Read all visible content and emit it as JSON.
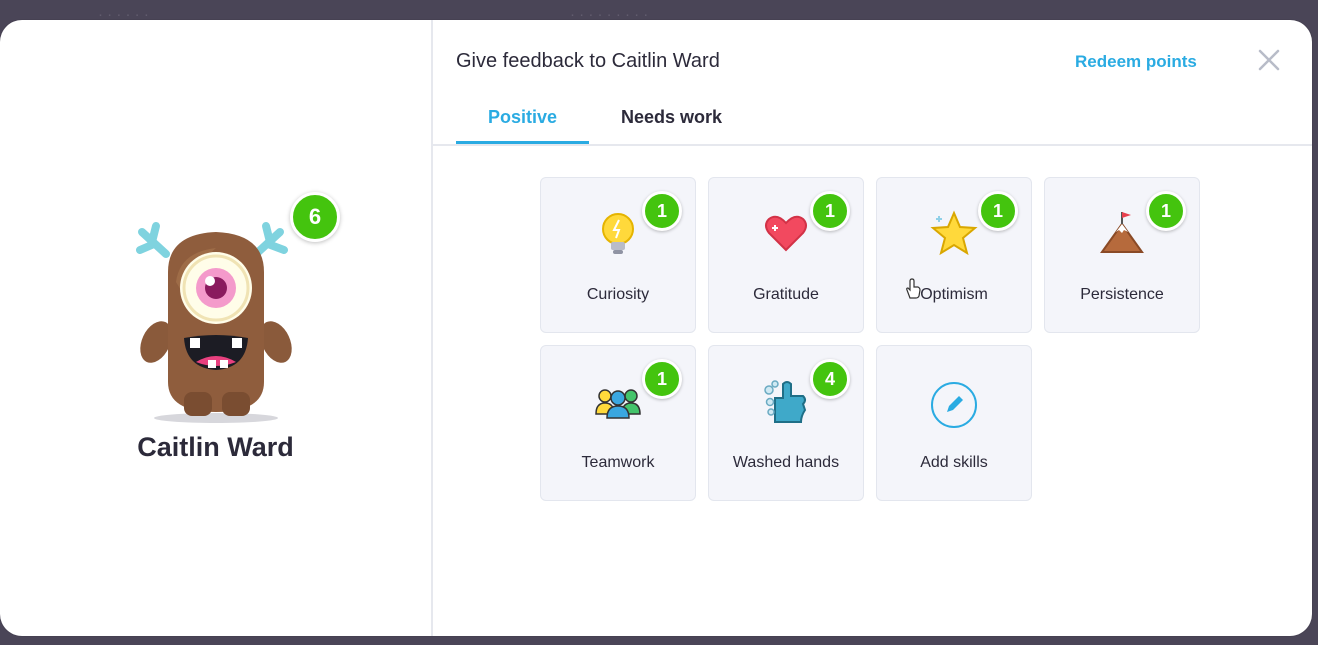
{
  "dialog": {
    "title": "Give feedback to Caitlin Ward",
    "redeem_label": "Redeem points",
    "close_icon": "close-icon"
  },
  "student": {
    "name": "Caitlin Ward",
    "points": "6",
    "avatar": "brown-monster-avatar"
  },
  "tabs": [
    {
      "label": "Positive",
      "active": true
    },
    {
      "label": "Needs work",
      "active": false
    }
  ],
  "skills": [
    {
      "label": "Curiosity",
      "count": "1",
      "icon": "lightbulb-icon"
    },
    {
      "label": "Gratitude",
      "count": "1",
      "icon": "heart-icon"
    },
    {
      "label": "Optimism",
      "count": "1",
      "icon": "star-icon"
    },
    {
      "label": "Persistence",
      "count": "1",
      "icon": "mountain-flag-icon"
    },
    {
      "label": "Teamwork",
      "count": "1",
      "icon": "people-icon"
    },
    {
      "label": "Washed hands",
      "count": "4",
      "icon": "soapy-hand-icon"
    },
    {
      "label": "Add skills",
      "count": null,
      "icon": "pencil-icon"
    }
  ],
  "colors": {
    "accent": "#2aabe2",
    "badge": "#44c40e"
  }
}
